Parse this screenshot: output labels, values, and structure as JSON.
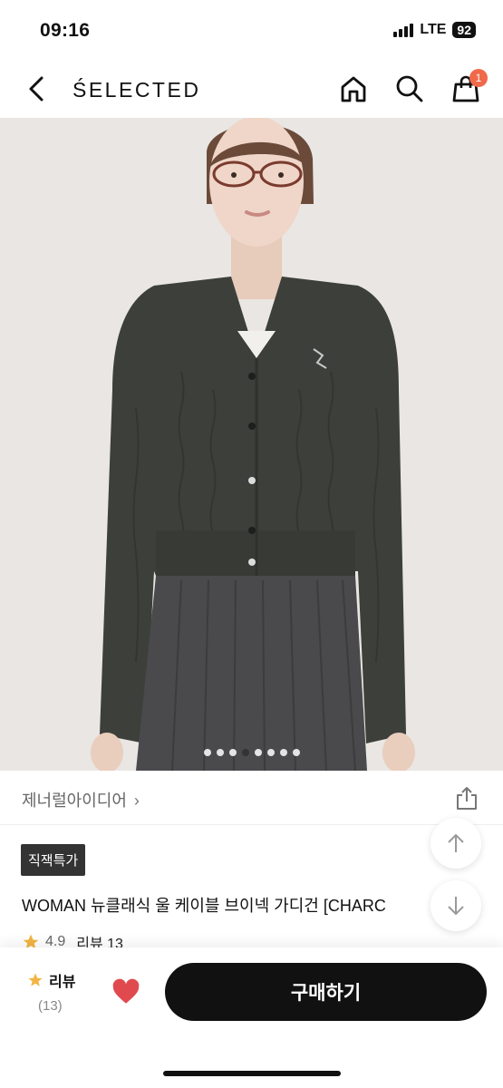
{
  "status": {
    "time": "09:16",
    "network": "LTE",
    "battery": "92"
  },
  "header": {
    "brand": "ŚELECTED",
    "cart_count": "1"
  },
  "gallery": {
    "dot_count": 8,
    "active_index": 3
  },
  "seller": {
    "name": "제너럴아이디어",
    "chevron": "›"
  },
  "product": {
    "tag": "직잭특가",
    "title": "WOMAN 뉴클래식 울 케이블 브이넥 가디건 [CHARC",
    "rating": "4.9",
    "review_link": "리뷰 13"
  },
  "bottom": {
    "review_label": "리뷰",
    "review_count": "(13)",
    "buy_label": "구매하기"
  },
  "colors": {
    "cart_badge": "#f0694a",
    "heart": "#e04a4f",
    "star": "#f2b544",
    "cardigan": "#3d3f3b",
    "skirt": "#4a4a4c",
    "background": "#e9e6e3"
  }
}
